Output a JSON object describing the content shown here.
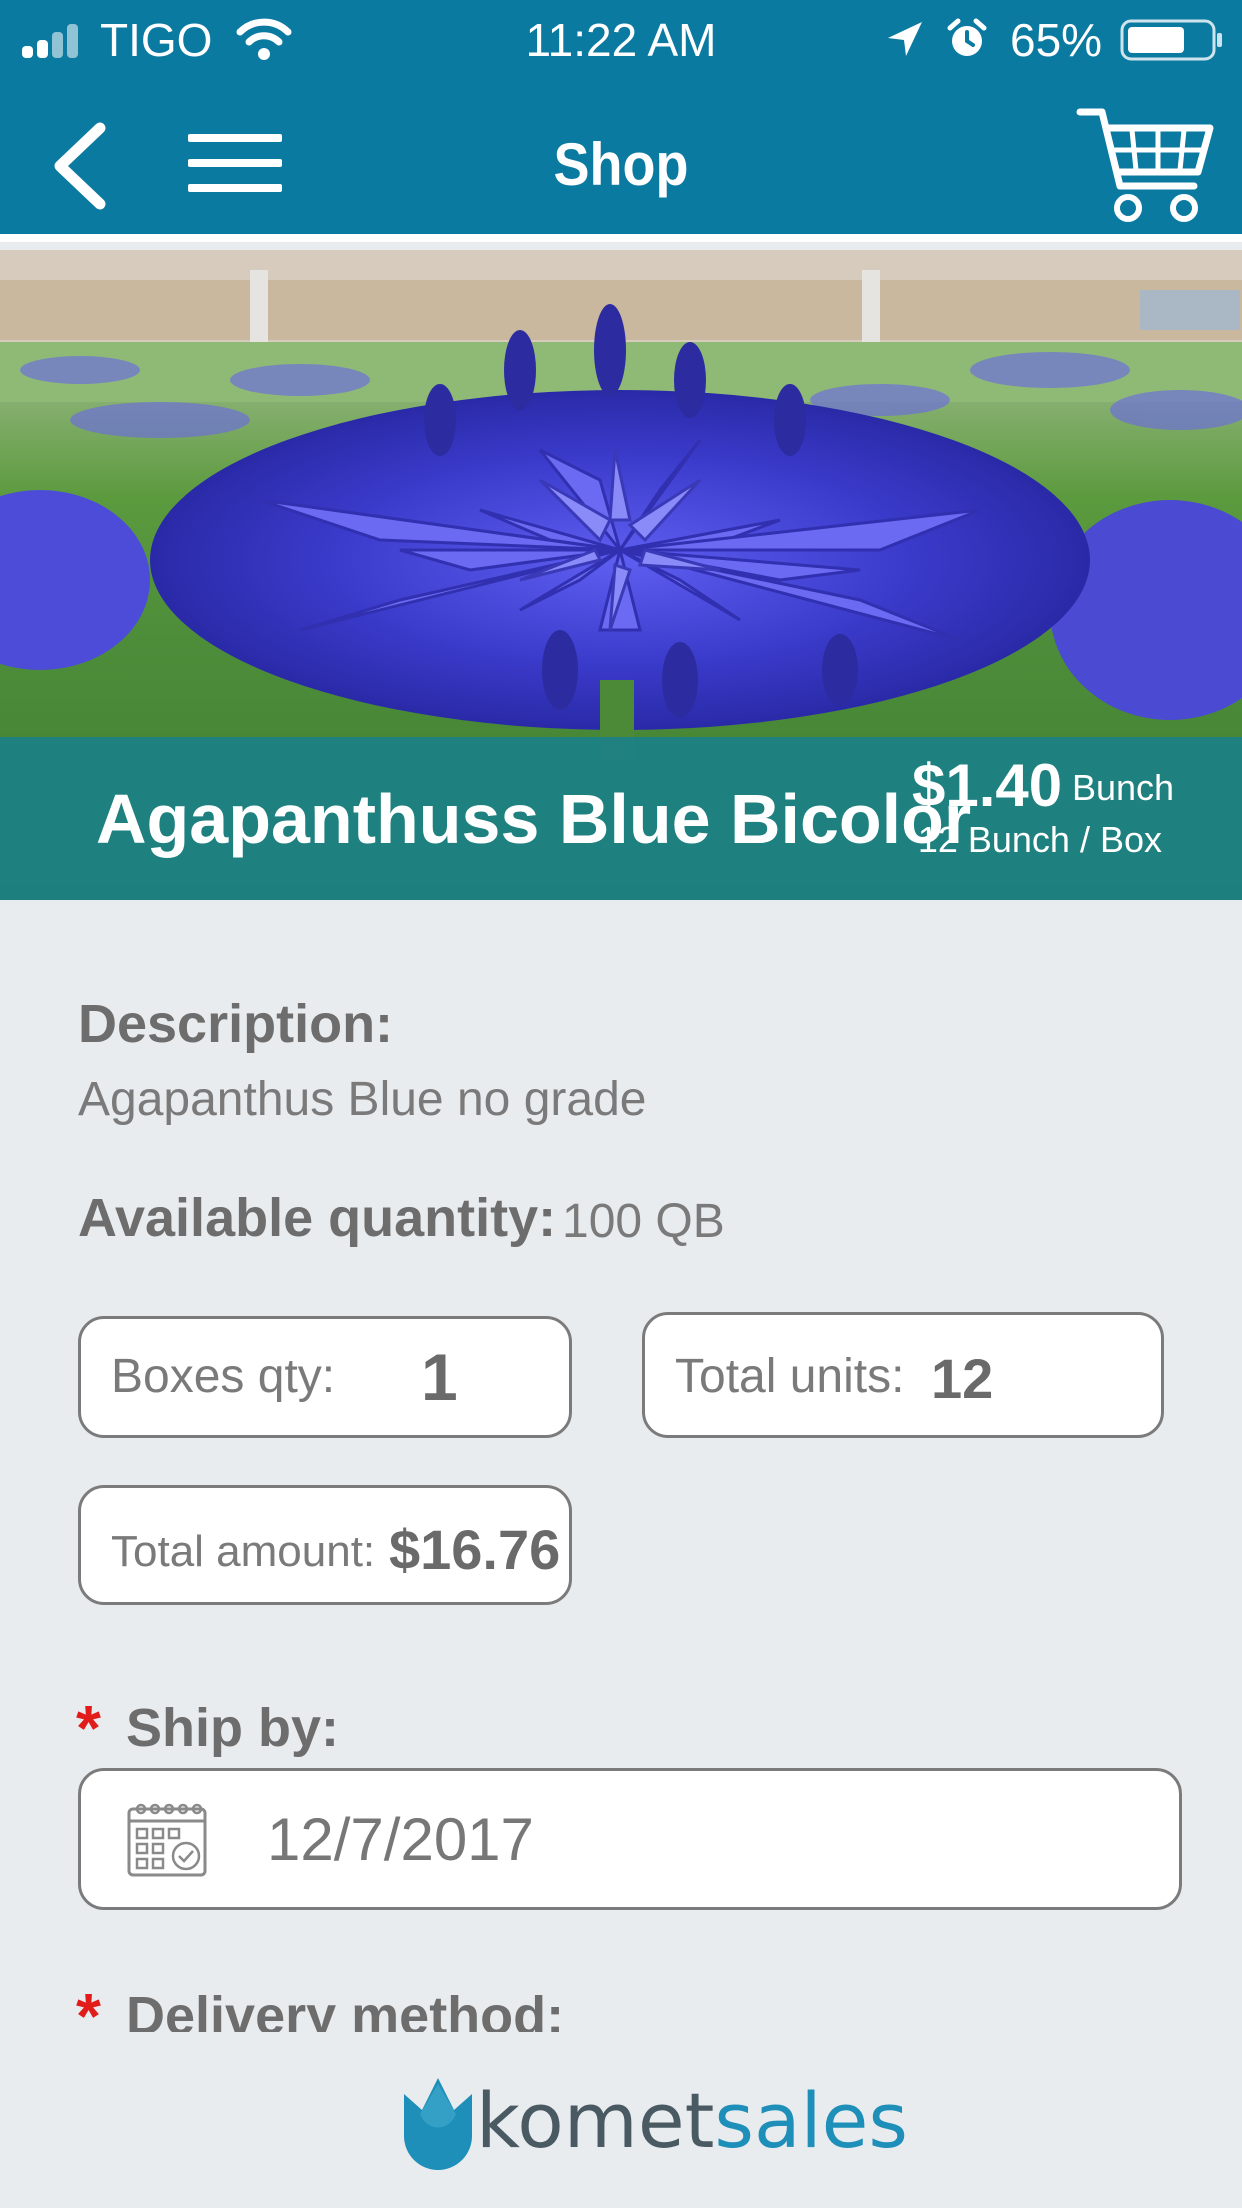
{
  "status_bar": {
    "carrier": "TIGO",
    "time": "11:22 AM",
    "battery": "65%"
  },
  "nav": {
    "title": "Shop",
    "icons": [
      "back-icon",
      "menu-icon",
      "cart-icon"
    ]
  },
  "product": {
    "name": "Agapanthuss Blue Bicolor",
    "price": "$1.40",
    "price_unit": "Bunch",
    "pack_info": "12 Bunch / Box"
  },
  "details": {
    "description_label": "Description:",
    "description": "Agapanthus Blue no grade",
    "available_label": "Available quantity:",
    "available_value": "100 QB"
  },
  "order": {
    "boxes_label": "Boxes qty:",
    "boxes_value": "1",
    "units_label": "Total units:",
    "units_value": "12",
    "amount_label": "Total amount:",
    "amount_value": "$16.76"
  },
  "shipping": {
    "required_mark": "*",
    "ship_by_label": "Ship by:",
    "ship_by_value": "12/7/2017",
    "delivery_label": "Delivery method:"
  },
  "footer": {
    "logo_part1": "komet",
    "logo_part2": "sales"
  },
  "colors": {
    "primary": "#0b7aa0",
    "band": "#18808c",
    "background": "#e9ecef",
    "required": "#e21b1b",
    "logo_dark": "#4a5a63",
    "logo_accent": "#1e8fb8"
  }
}
